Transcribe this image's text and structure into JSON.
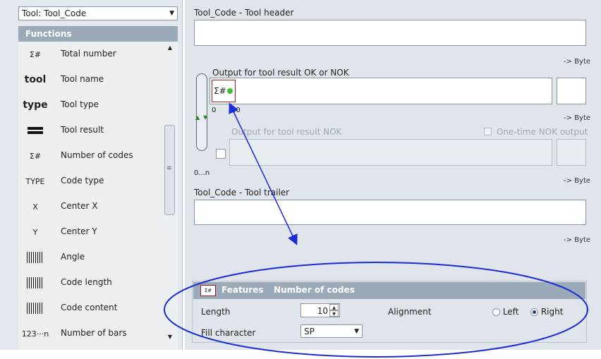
{
  "tool_selector": {
    "value": "Tool: Tool_Code"
  },
  "functions": {
    "header": "Functions",
    "items": [
      {
        "icon_text": "Σ#",
        "icon": "sum-count-icon",
        "label": "Total number"
      },
      {
        "icon_text": "tool",
        "icon": "tool-word-icon",
        "label": "Tool name"
      },
      {
        "icon_text": "type",
        "icon": "type-word-icon",
        "label": "Tool type"
      },
      {
        "icon_text": "",
        "icon": "double-bar-icon",
        "label": "Tool result"
      },
      {
        "icon_text": "Σ#",
        "icon": "sum-count-green-icon",
        "label": "Number of codes"
      },
      {
        "icon_text": "TYPE",
        "icon": "barcode-type-icon",
        "label": "Code type"
      },
      {
        "icon_text": "X",
        "icon": "center-x-icon",
        "label": "Center X"
      },
      {
        "icon_text": "Y",
        "icon": "center-y-icon",
        "label": "Center Y"
      },
      {
        "icon_text": "",
        "icon": "angle-icon",
        "label": "Angle"
      },
      {
        "icon_text": "",
        "icon": "barcode-length-icon",
        "label": "Code length"
      },
      {
        "icon_text": "",
        "icon": "barcode-content-icon",
        "label": "Code content"
      },
      {
        "icon_text": "123···n",
        "icon": "barcode-bars-icon",
        "label": "Number of bars"
      }
    ]
  },
  "header_section": {
    "label": "Tool_Code - Tool header",
    "byte": "-> Byte"
  },
  "ok_section": {
    "label": "Output for tool result OK or NOK",
    "field_token": "Σ#",
    "range_start": "0",
    "range_end": "10",
    "byte": "-> Byte"
  },
  "nok_section": {
    "label": "Output for tool result NOK",
    "onetime_label": "One-time NOK output",
    "byte": "-> Byte",
    "repeat_label": "0...n"
  },
  "trailer_section": {
    "label": "Tool_Code - Tool trailer",
    "byte": "-> Byte"
  },
  "features": {
    "title": "Features",
    "subtitle": "Number of codes",
    "length_label": "Length",
    "length_value": "10",
    "alignment_label": "Alignment",
    "align_left": "Left",
    "align_right": "Right",
    "align_selected": "Right",
    "fill_label": "Fill character",
    "fill_value": "SP"
  },
  "annotation_color": "#1c2bd8"
}
